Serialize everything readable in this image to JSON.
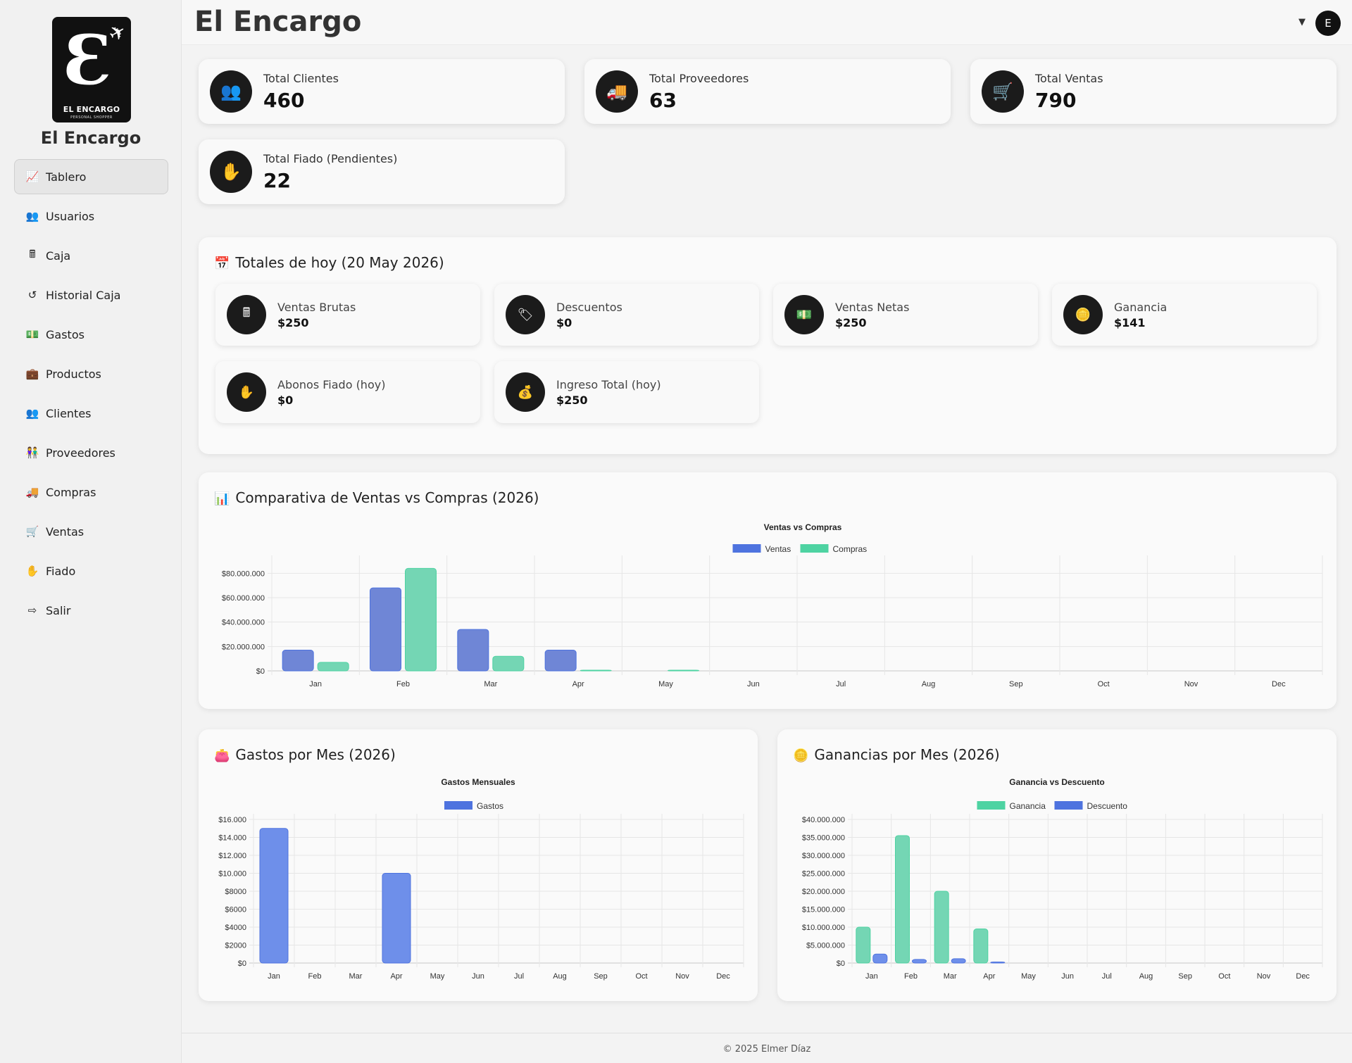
{
  "sidebar": {
    "logo_text": "EL ENCARGO",
    "logo_subtext": "PERSONAL SHOPPER",
    "app_name": "El Encargo",
    "items": [
      {
        "label": "Tablero",
        "icon": "chart-line-icon",
        "active": true
      },
      {
        "label": "Usuarios",
        "icon": "users-cog-icon"
      },
      {
        "label": "Caja",
        "icon": "cash-register-icon"
      },
      {
        "label": "Historial Caja",
        "icon": "history-icon"
      },
      {
        "label": "Gastos",
        "icon": "money-bill-icon"
      },
      {
        "label": "Productos",
        "icon": "briefcase-icon"
      },
      {
        "label": "Clientes",
        "icon": "users-icon"
      },
      {
        "label": "Proveedores",
        "icon": "people-carry-icon"
      },
      {
        "label": "Compras",
        "icon": "truck-icon"
      },
      {
        "label": "Ventas",
        "icon": "cart-icon"
      },
      {
        "label": "Fiado",
        "icon": "hand-holding-dollar-icon"
      },
      {
        "label": "Salir",
        "icon": "sign-out-icon"
      }
    ]
  },
  "header": {
    "title": "El Encargo",
    "user_initial": "E"
  },
  "stats": {
    "clientes": {
      "label": "Total Clientes",
      "value": "460"
    },
    "proveedores": {
      "label": "Total Proveedores",
      "value": "63"
    },
    "ventas": {
      "label": "Total Ventas",
      "value": "790"
    },
    "fiado": {
      "label": "Total Fiado (Pendientes)",
      "value": "22"
    }
  },
  "today": {
    "title": "Totales de hoy (20 May 2026)",
    "cards": [
      {
        "label": "Ventas Brutas",
        "value": "$250",
        "icon": "cash-register-icon"
      },
      {
        "label": "Descuentos",
        "value": "$0",
        "icon": "tags-icon"
      },
      {
        "label": "Ventas Netas",
        "value": "$250",
        "icon": "money-bill-icon"
      },
      {
        "label": "Ganancia",
        "value": "$141",
        "icon": "coins-icon"
      },
      {
        "label": "Abonos Fiado (hoy)",
        "value": "$0",
        "icon": "hand-holding-dollar-icon"
      },
      {
        "label": "Ingreso Total (hoy)",
        "value": "$250",
        "icon": "money-bag-icon"
      }
    ]
  },
  "panels": {
    "comparativa_title": "Comparativa de Ventas vs Compras (2026)",
    "gastos_title": "Gastos por Mes (2026)",
    "ganancias_title": "Ganancias por Mes (2026)"
  },
  "chart_data": [
    {
      "id": "ventas_compras",
      "type": "bar",
      "title": "Ventas vs Compras",
      "categories": [
        "Jan",
        "Feb",
        "Mar",
        "Apr",
        "May",
        "Jun",
        "Jul",
        "Aug",
        "Sep",
        "Oct",
        "Nov",
        "Dec"
      ],
      "series": [
        {
          "name": "Ventas",
          "color": "#6f86d6",
          "legend_color": "#4e73df",
          "values": [
            17000000,
            68000000,
            34000000,
            17000000,
            0,
            0,
            0,
            0,
            0,
            0,
            0,
            0
          ]
        },
        {
          "name": "Compras",
          "color": "#74d6b4",
          "legend_color": "#4ed3a2",
          "values": [
            7000000,
            84000000,
            12000000,
            400000,
            300000,
            0,
            0,
            0,
            0,
            0,
            0,
            0
          ]
        }
      ],
      "ylim": [
        0,
        90000000
      ],
      "yticks": [
        0,
        20000000,
        40000000,
        60000000,
        80000000
      ],
      "ytick_labels": [
        "$0",
        "$20.000.000",
        "$40.000.000",
        "$60.000.000",
        "$80.000.000"
      ],
      "grid": true,
      "legend": "top"
    },
    {
      "id": "gastos",
      "type": "bar",
      "title": "Gastos Mensuales",
      "categories": [
        "Jan",
        "Feb",
        "Mar",
        "Apr",
        "May",
        "Jun",
        "Jul",
        "Aug",
        "Sep",
        "Oct",
        "Nov",
        "Dec"
      ],
      "series": [
        {
          "name": "Gastos",
          "color": "#6e8fea",
          "legend_color": "#4e73df",
          "values": [
            15000,
            0,
            0,
            10000,
            0,
            0,
            0,
            0,
            0,
            0,
            0,
            0
          ]
        }
      ],
      "ylim": [
        0,
        16000
      ],
      "yticks": [
        0,
        2000,
        4000,
        6000,
        8000,
        10000,
        12000,
        14000,
        16000
      ],
      "ytick_labels": [
        "$0",
        "$2000",
        "$4000",
        "$6000",
        "$8000",
        "$10.000",
        "$12.000",
        "$14.000",
        "$16.000"
      ],
      "grid": true,
      "legend": "top"
    },
    {
      "id": "ganancias",
      "type": "bar",
      "title": "Ganancia vs Descuento",
      "categories": [
        "Jan",
        "Feb",
        "Mar",
        "Apr",
        "May",
        "Jun",
        "Jul",
        "Aug",
        "Sep",
        "Oct",
        "Nov",
        "Dec"
      ],
      "series": [
        {
          "name": "Ganancia",
          "color": "#74d6b4",
          "legend_color": "#4ed3a2",
          "values": [
            10000000,
            35500000,
            20000000,
            9500000,
            0,
            0,
            0,
            0,
            0,
            0,
            0,
            0
          ]
        },
        {
          "name": "Descuento",
          "color": "#6e8fea",
          "legend_color": "#4e73df",
          "values": [
            2500000,
            1000000,
            1200000,
            300000,
            0,
            0,
            0,
            0,
            0,
            0,
            0,
            0
          ]
        }
      ],
      "ylim": [
        0,
        40000000
      ],
      "yticks": [
        0,
        5000000,
        10000000,
        15000000,
        20000000,
        25000000,
        30000000,
        35000000,
        40000000
      ],
      "ytick_labels": [
        "$0",
        "$5.000.000",
        "$10.000.000",
        "$15.000.000",
        "$20.000.000",
        "$25.000.000",
        "$30.000.000",
        "$35.000.000",
        "$40.000.000"
      ],
      "grid": true,
      "legend": "top"
    }
  ],
  "footer": {
    "text": "© 2025 Elmer Díaz"
  }
}
